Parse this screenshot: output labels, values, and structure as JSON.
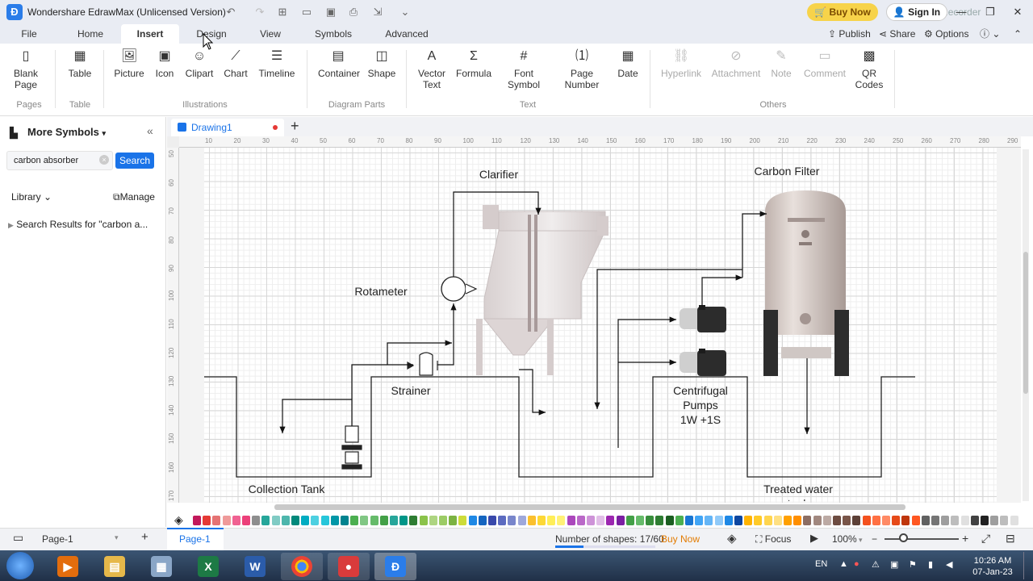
{
  "window": {
    "title": "Wondershare EdrawMax (Unlicensed Version)",
    "buy_now": "Buy Now",
    "sign_in": "Sign In",
    "watermark": "with Screen Recorder"
  },
  "menu": {
    "tabs": [
      "File",
      "Home",
      "Insert",
      "Design",
      "View",
      "Symbols",
      "Advanced"
    ],
    "active": "Insert",
    "right": {
      "publish": "Publish",
      "share": "Share",
      "options": "Options"
    }
  },
  "ribbon": {
    "blank_page": "Blank\nPage",
    "table": "Table",
    "picture": "Picture",
    "icon": "Icon",
    "clipart": "Clipart",
    "chart": "Chart",
    "timeline": "Timeline",
    "container": "Container",
    "shape": "Shape",
    "vector_text": "Vector\nText",
    "formula": "Formula",
    "font_symbol": "Font\nSymbol",
    "page_number": "Page\nNumber",
    "date": "Date",
    "hyperlink": "Hyperlink",
    "attachment": "Attachment",
    "note": "Note",
    "comment": "Comment",
    "qr_codes": "QR\nCodes",
    "groups": {
      "pages": "Pages",
      "table": "Table",
      "illustrations": "Illustrations",
      "diagram_parts": "Diagram Parts",
      "text": "Text",
      "others": "Others"
    }
  },
  "left_panel": {
    "title": "More Symbols",
    "search_value": "carbon absorber",
    "search_button": "Search",
    "library": "Library",
    "manage": "Manage",
    "results": "Search Results for  \"carbon a..."
  },
  "document": {
    "tab": "Drawing1"
  },
  "ruler": {
    "h_ticks": [
      "10",
      "20",
      "30",
      "40",
      "50",
      "60",
      "70",
      "80",
      "90",
      "100",
      "110",
      "120",
      "130",
      "140",
      "150",
      "160",
      "170",
      "180",
      "190",
      "200",
      "210",
      "220",
      "230",
      "240",
      "250",
      "260",
      "270",
      "280",
      "290"
    ],
    "v_ticks": [
      "50",
      "60",
      "70",
      "80",
      "90",
      "100",
      "110",
      "120",
      "130",
      "140",
      "150",
      "160",
      "170"
    ]
  },
  "diagram": {
    "clarifier": "Clarifier",
    "carbon_filter": "Carbon Filter",
    "rotameter": "Rotameter",
    "strainer": "Strainer",
    "pumps_line1": "Centrifugal",
    "pumps_line2": "Pumps",
    "pumps_line3": "1W +1S",
    "collection_tank": "Collection Tank",
    "treated_tank": "Treated water\ntank"
  },
  "palette": [
    "#c2185b",
    "#e53935",
    "#e57373",
    "#ef9a9a",
    "#f06292",
    "#ec407a",
    "#8e8e8e",
    "#26a69a",
    "#80cbc4",
    "#4db6ac",
    "#00897b",
    "#00acc1",
    "#4dd0e1",
    "#26c6da",
    "#0097a7",
    "#00838f",
    "#4caf50",
    "#81c784",
    "#66bb6a",
    "#43a047",
    "#26a69a",
    "#009688",
    "#2e7d32",
    "#8bc34a",
    "#aed581",
    "#9ccc65",
    "#7cb342",
    "#cddc39",
    "#1e88e5",
    "#1565c0",
    "#3949ab",
    "#5c6bc0",
    "#7986cb",
    "#9fa8da",
    "#fbc02d",
    "#fdd835",
    "#ffee58",
    "#fff176",
    "#ab47bc",
    "#ba68c8",
    "#ce93d8",
    "#e1bee7",
    "#9c27b0",
    "#7b1fa2",
    "#43a047",
    "#66bb6a",
    "#388e3c",
    "#2e7d32",
    "#1b5e20",
    "#4caf50",
    "#1976d2",
    "#42a5f5",
    "#64b5f6",
    "#90caf9",
    "#1e88e5",
    "#0d47a1",
    "#ffb300",
    "#ffca28",
    "#ffd54f",
    "#ffe082",
    "#ffa000",
    "#ff8f00",
    "#8d6e63",
    "#a1887f",
    "#bcaaa4",
    "#6d4c41",
    "#795548",
    "#5d4037",
    "#f4511e",
    "#ff7043",
    "#ff8a65",
    "#e64a19",
    "#bf360c",
    "#ff5722",
    "#616161",
    "#757575",
    "#9e9e9e",
    "#bdbdbd",
    "#e0e0e0",
    "#424242",
    "#212121",
    "#9e9e9e",
    "#bdbdbd",
    "#e0e0e0"
  ],
  "status": {
    "page_select": "Page-1",
    "page_tab": "Page-1",
    "shapes": "Number of shapes: 17/60",
    "buy_now": "Buy Now",
    "focus": "Focus",
    "zoom": "100%"
  },
  "taskbar": {
    "lang": "EN",
    "time": "10:26 AM",
    "date": "07-Jan-23"
  }
}
